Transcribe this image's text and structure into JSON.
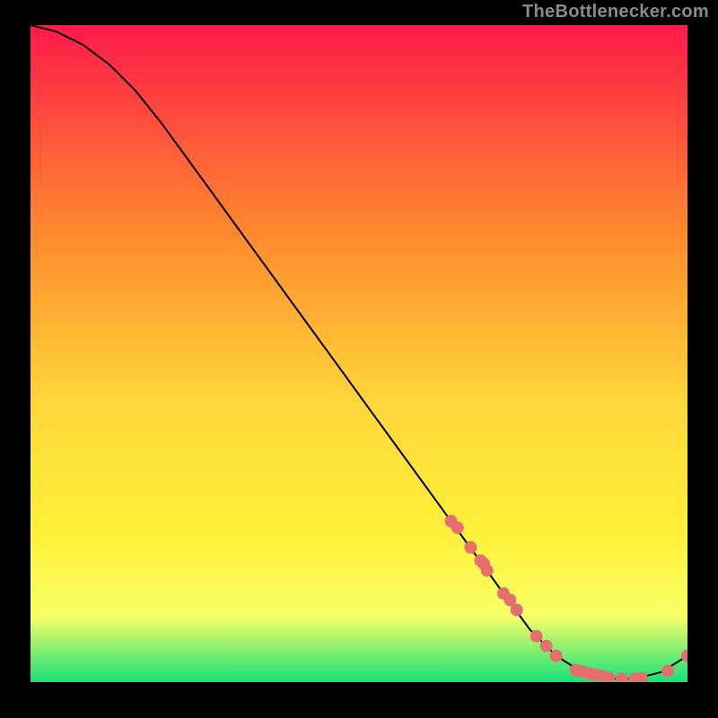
{
  "watermark": "TheBottlenecker.com",
  "colors": {
    "line": "#000000",
    "marker": "#e36f6f",
    "gradient_top": "#ff1a4a",
    "gradient_mid_upper": "#ff8b2e",
    "gradient_mid": "#ffd83a",
    "gradient_mid_lower": "#fff13a",
    "gradient_band": "#f7ff66",
    "gradient_bottom": "#18e07a"
  },
  "chart_data": {
    "type": "line",
    "title": "",
    "xlabel": "",
    "ylabel": "",
    "xlim": [
      0,
      100
    ],
    "ylim": [
      0,
      100
    ],
    "x": [
      0,
      4,
      8,
      12,
      16,
      20,
      24,
      28,
      32,
      36,
      40,
      44,
      48,
      52,
      56,
      60,
      64,
      68,
      72,
      76,
      80,
      84,
      88,
      92,
      96,
      100
    ],
    "values": [
      100,
      99,
      97,
      94,
      90,
      85,
      79.5,
      74,
      68.5,
      63,
      57.5,
      52,
      46.5,
      41,
      35.5,
      30,
      24.5,
      19,
      13.5,
      8,
      4,
      1.5,
      0.5,
      0.5,
      1.5,
      4
    ],
    "markers_x": [
      64,
      65,
      67,
      68.5,
      69,
      69.5,
      72,
      73,
      74,
      77,
      78.5,
      80,
      83,
      84,
      85,
      86,
      87,
      88,
      90,
      92,
      93,
      97,
      100
    ],
    "markers_y": [
      24.5,
      23.5,
      20.5,
      18.5,
      18,
      17,
      13.5,
      12.5,
      11,
      7,
      5.5,
      4,
      1.8,
      1.6,
      1.3,
      1.1,
      0.9,
      0.7,
      0.5,
      0.5,
      0.6,
      1.7,
      4
    ]
  }
}
